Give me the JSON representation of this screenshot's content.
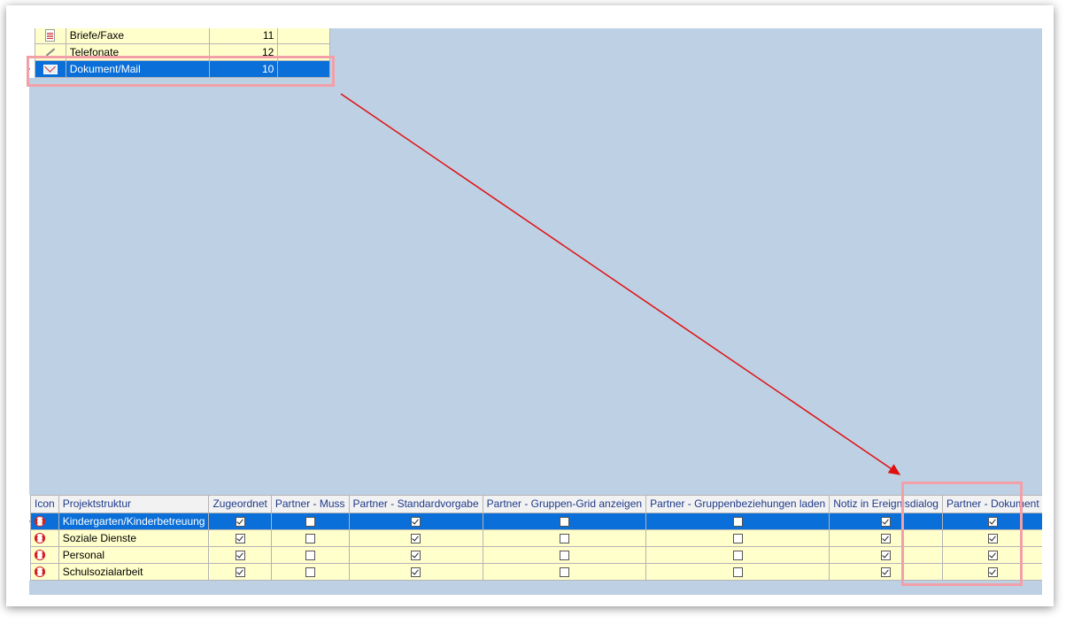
{
  "top_grid": {
    "rows": [
      {
        "label": "Briefe/Faxe",
        "value": "11",
        "icon": "document-icon",
        "selected": false
      },
      {
        "label": "Telefonate",
        "value": "12",
        "icon": "pen-icon",
        "selected": false
      },
      {
        "label": "Dokument/Mail",
        "value": "10",
        "icon": "mail-icon",
        "selected": true
      }
    ]
  },
  "bottom_grid": {
    "headers": [
      "Icon",
      "Projektstruktur",
      "Zugeordnet",
      "Partner - Muss",
      "Partner - Standardvorgabe",
      "Partner - Gruppen-Grid anzeigen",
      "Partner - Gruppenbeziehungen laden",
      "Notiz in Ereignisdialog",
      "Partner - Dokument"
    ],
    "rows": [
      {
        "name": "Kindergarten/Kinderbetreuung",
        "checks": [
          true,
          false,
          true,
          false,
          false,
          true,
          true
        ],
        "selected": true
      },
      {
        "name": "Soziale Dienste",
        "checks": [
          true,
          false,
          true,
          false,
          false,
          true,
          true
        ],
        "selected": false
      },
      {
        "name": "Personal",
        "checks": [
          true,
          false,
          true,
          false,
          false,
          true,
          true
        ],
        "selected": false
      },
      {
        "name": "Schulsozialarbeit",
        "checks": [
          true,
          false,
          true,
          false,
          false,
          true,
          true
        ],
        "selected": false
      }
    ]
  },
  "colors": {
    "selection": "#0a6fd8",
    "highlight": "#f2a0a8",
    "arrow": "#e01010",
    "grid_bg": "#ffffcc",
    "canvas_bg": "#bdd0e4"
  }
}
